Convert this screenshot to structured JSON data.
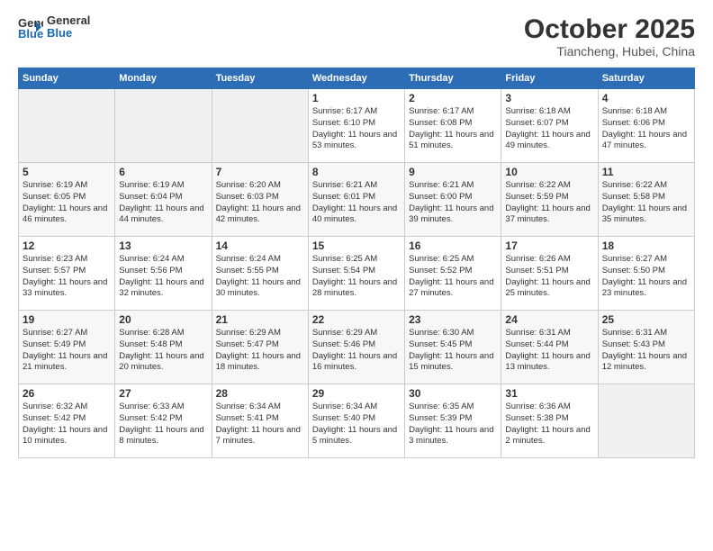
{
  "header": {
    "logo_line1": "General",
    "logo_line2": "Blue",
    "month": "October 2025",
    "location": "Tiancheng, Hubei, China"
  },
  "weekdays": [
    "Sunday",
    "Monday",
    "Tuesday",
    "Wednesday",
    "Thursday",
    "Friday",
    "Saturday"
  ],
  "weeks": [
    [
      {
        "day": "",
        "info": ""
      },
      {
        "day": "",
        "info": ""
      },
      {
        "day": "",
        "info": ""
      },
      {
        "day": "1",
        "info": "Sunrise: 6:17 AM\nSunset: 6:10 PM\nDaylight: 11 hours and 53 minutes."
      },
      {
        "day": "2",
        "info": "Sunrise: 6:17 AM\nSunset: 6:08 PM\nDaylight: 11 hours and 51 minutes."
      },
      {
        "day": "3",
        "info": "Sunrise: 6:18 AM\nSunset: 6:07 PM\nDaylight: 11 hours and 49 minutes."
      },
      {
        "day": "4",
        "info": "Sunrise: 6:18 AM\nSunset: 6:06 PM\nDaylight: 11 hours and 47 minutes."
      }
    ],
    [
      {
        "day": "5",
        "info": "Sunrise: 6:19 AM\nSunset: 6:05 PM\nDaylight: 11 hours and 46 minutes."
      },
      {
        "day": "6",
        "info": "Sunrise: 6:19 AM\nSunset: 6:04 PM\nDaylight: 11 hours and 44 minutes."
      },
      {
        "day": "7",
        "info": "Sunrise: 6:20 AM\nSunset: 6:03 PM\nDaylight: 11 hours and 42 minutes."
      },
      {
        "day": "8",
        "info": "Sunrise: 6:21 AM\nSunset: 6:01 PM\nDaylight: 11 hours and 40 minutes."
      },
      {
        "day": "9",
        "info": "Sunrise: 6:21 AM\nSunset: 6:00 PM\nDaylight: 11 hours and 39 minutes."
      },
      {
        "day": "10",
        "info": "Sunrise: 6:22 AM\nSunset: 5:59 PM\nDaylight: 11 hours and 37 minutes."
      },
      {
        "day": "11",
        "info": "Sunrise: 6:22 AM\nSunset: 5:58 PM\nDaylight: 11 hours and 35 minutes."
      }
    ],
    [
      {
        "day": "12",
        "info": "Sunrise: 6:23 AM\nSunset: 5:57 PM\nDaylight: 11 hours and 33 minutes."
      },
      {
        "day": "13",
        "info": "Sunrise: 6:24 AM\nSunset: 5:56 PM\nDaylight: 11 hours and 32 minutes."
      },
      {
        "day": "14",
        "info": "Sunrise: 6:24 AM\nSunset: 5:55 PM\nDaylight: 11 hours and 30 minutes."
      },
      {
        "day": "15",
        "info": "Sunrise: 6:25 AM\nSunset: 5:54 PM\nDaylight: 11 hours and 28 minutes."
      },
      {
        "day": "16",
        "info": "Sunrise: 6:25 AM\nSunset: 5:52 PM\nDaylight: 11 hours and 27 minutes."
      },
      {
        "day": "17",
        "info": "Sunrise: 6:26 AM\nSunset: 5:51 PM\nDaylight: 11 hours and 25 minutes."
      },
      {
        "day": "18",
        "info": "Sunrise: 6:27 AM\nSunset: 5:50 PM\nDaylight: 11 hours and 23 minutes."
      }
    ],
    [
      {
        "day": "19",
        "info": "Sunrise: 6:27 AM\nSunset: 5:49 PM\nDaylight: 11 hours and 21 minutes."
      },
      {
        "day": "20",
        "info": "Sunrise: 6:28 AM\nSunset: 5:48 PM\nDaylight: 11 hours and 20 minutes."
      },
      {
        "day": "21",
        "info": "Sunrise: 6:29 AM\nSunset: 5:47 PM\nDaylight: 11 hours and 18 minutes."
      },
      {
        "day": "22",
        "info": "Sunrise: 6:29 AM\nSunset: 5:46 PM\nDaylight: 11 hours and 16 minutes."
      },
      {
        "day": "23",
        "info": "Sunrise: 6:30 AM\nSunset: 5:45 PM\nDaylight: 11 hours and 15 minutes."
      },
      {
        "day": "24",
        "info": "Sunrise: 6:31 AM\nSunset: 5:44 PM\nDaylight: 11 hours and 13 minutes."
      },
      {
        "day": "25",
        "info": "Sunrise: 6:31 AM\nSunset: 5:43 PM\nDaylight: 11 hours and 12 minutes."
      }
    ],
    [
      {
        "day": "26",
        "info": "Sunrise: 6:32 AM\nSunset: 5:42 PM\nDaylight: 11 hours and 10 minutes."
      },
      {
        "day": "27",
        "info": "Sunrise: 6:33 AM\nSunset: 5:42 PM\nDaylight: 11 hours and 8 minutes."
      },
      {
        "day": "28",
        "info": "Sunrise: 6:34 AM\nSunset: 5:41 PM\nDaylight: 11 hours and 7 minutes."
      },
      {
        "day": "29",
        "info": "Sunrise: 6:34 AM\nSunset: 5:40 PM\nDaylight: 11 hours and 5 minutes."
      },
      {
        "day": "30",
        "info": "Sunrise: 6:35 AM\nSunset: 5:39 PM\nDaylight: 11 hours and 3 minutes."
      },
      {
        "day": "31",
        "info": "Sunrise: 6:36 AM\nSunset: 5:38 PM\nDaylight: 11 hours and 2 minutes."
      },
      {
        "day": "",
        "info": ""
      }
    ]
  ]
}
